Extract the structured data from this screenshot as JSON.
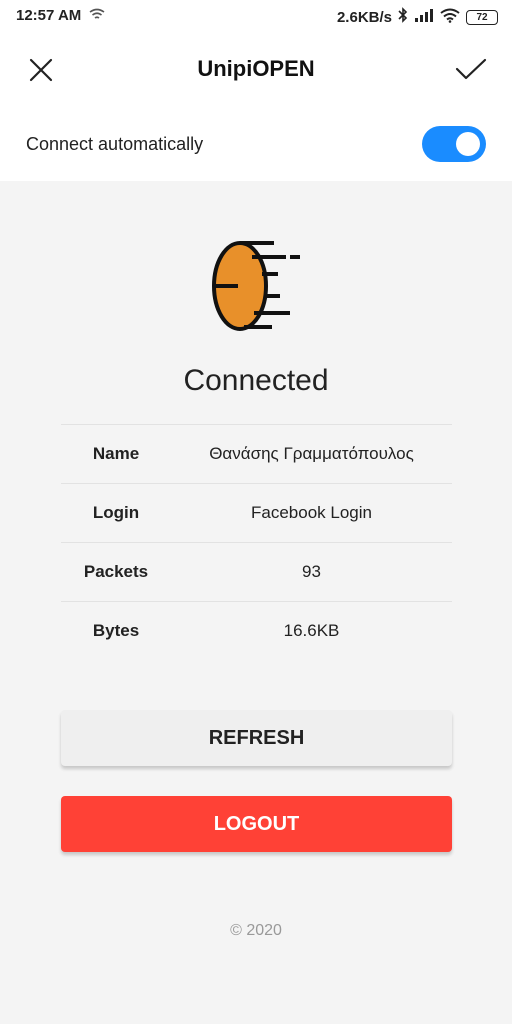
{
  "status_bar": {
    "time": "12:57 AM",
    "network_speed": "2.6KB/s",
    "battery_level": "72",
    "icons": [
      "wifi-hotspot-icon",
      "bluetooth-icon",
      "signal-icon",
      "wifi-icon",
      "battery-icon"
    ]
  },
  "app_bar": {
    "title": "UnipiOPEN",
    "close_icon": "close-icon",
    "confirm_icon": "check-icon"
  },
  "auto_connect": {
    "label": "Connect automatically",
    "enabled": true
  },
  "main": {
    "status": "Connected",
    "logo_icon": "orange-moving-coin-icon",
    "rows": [
      {
        "key": "Name",
        "value": "Θανάσης Γραμματόπουλος"
      },
      {
        "key": "Login",
        "value": "Facebook Login"
      },
      {
        "key": "Packets",
        "value": "93"
      },
      {
        "key": "Bytes",
        "value": "16.6KB"
      }
    ]
  },
  "actions": {
    "refresh_label": "REFRESH",
    "logout_label": "LOGOUT"
  },
  "footer": {
    "copyright": "© 2020"
  },
  "colors": {
    "accent": "#1a8cff",
    "logout": "#ff4136",
    "logo_fill": "#e8902a"
  }
}
